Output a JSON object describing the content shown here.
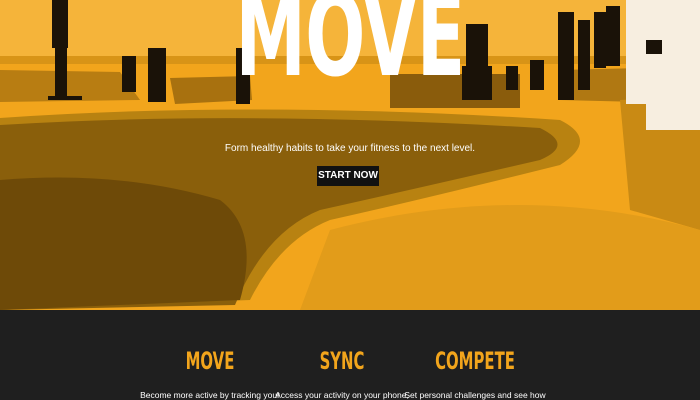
{
  "hero": {
    "title": "MOVE",
    "tagline": "Form healthy habits to take your fitness to the next level.",
    "cta_label": "START NOW",
    "accent_color": "#f2a51c",
    "image": "skatepark-photo"
  },
  "features": [
    {
      "title": "MOVE",
      "text": "Become more active by tracking your"
    },
    {
      "title": "SYNC",
      "text": "Access your activity on your phone,"
    },
    {
      "title": "COMPETE",
      "text": "Set personal challenges and see how"
    }
  ]
}
